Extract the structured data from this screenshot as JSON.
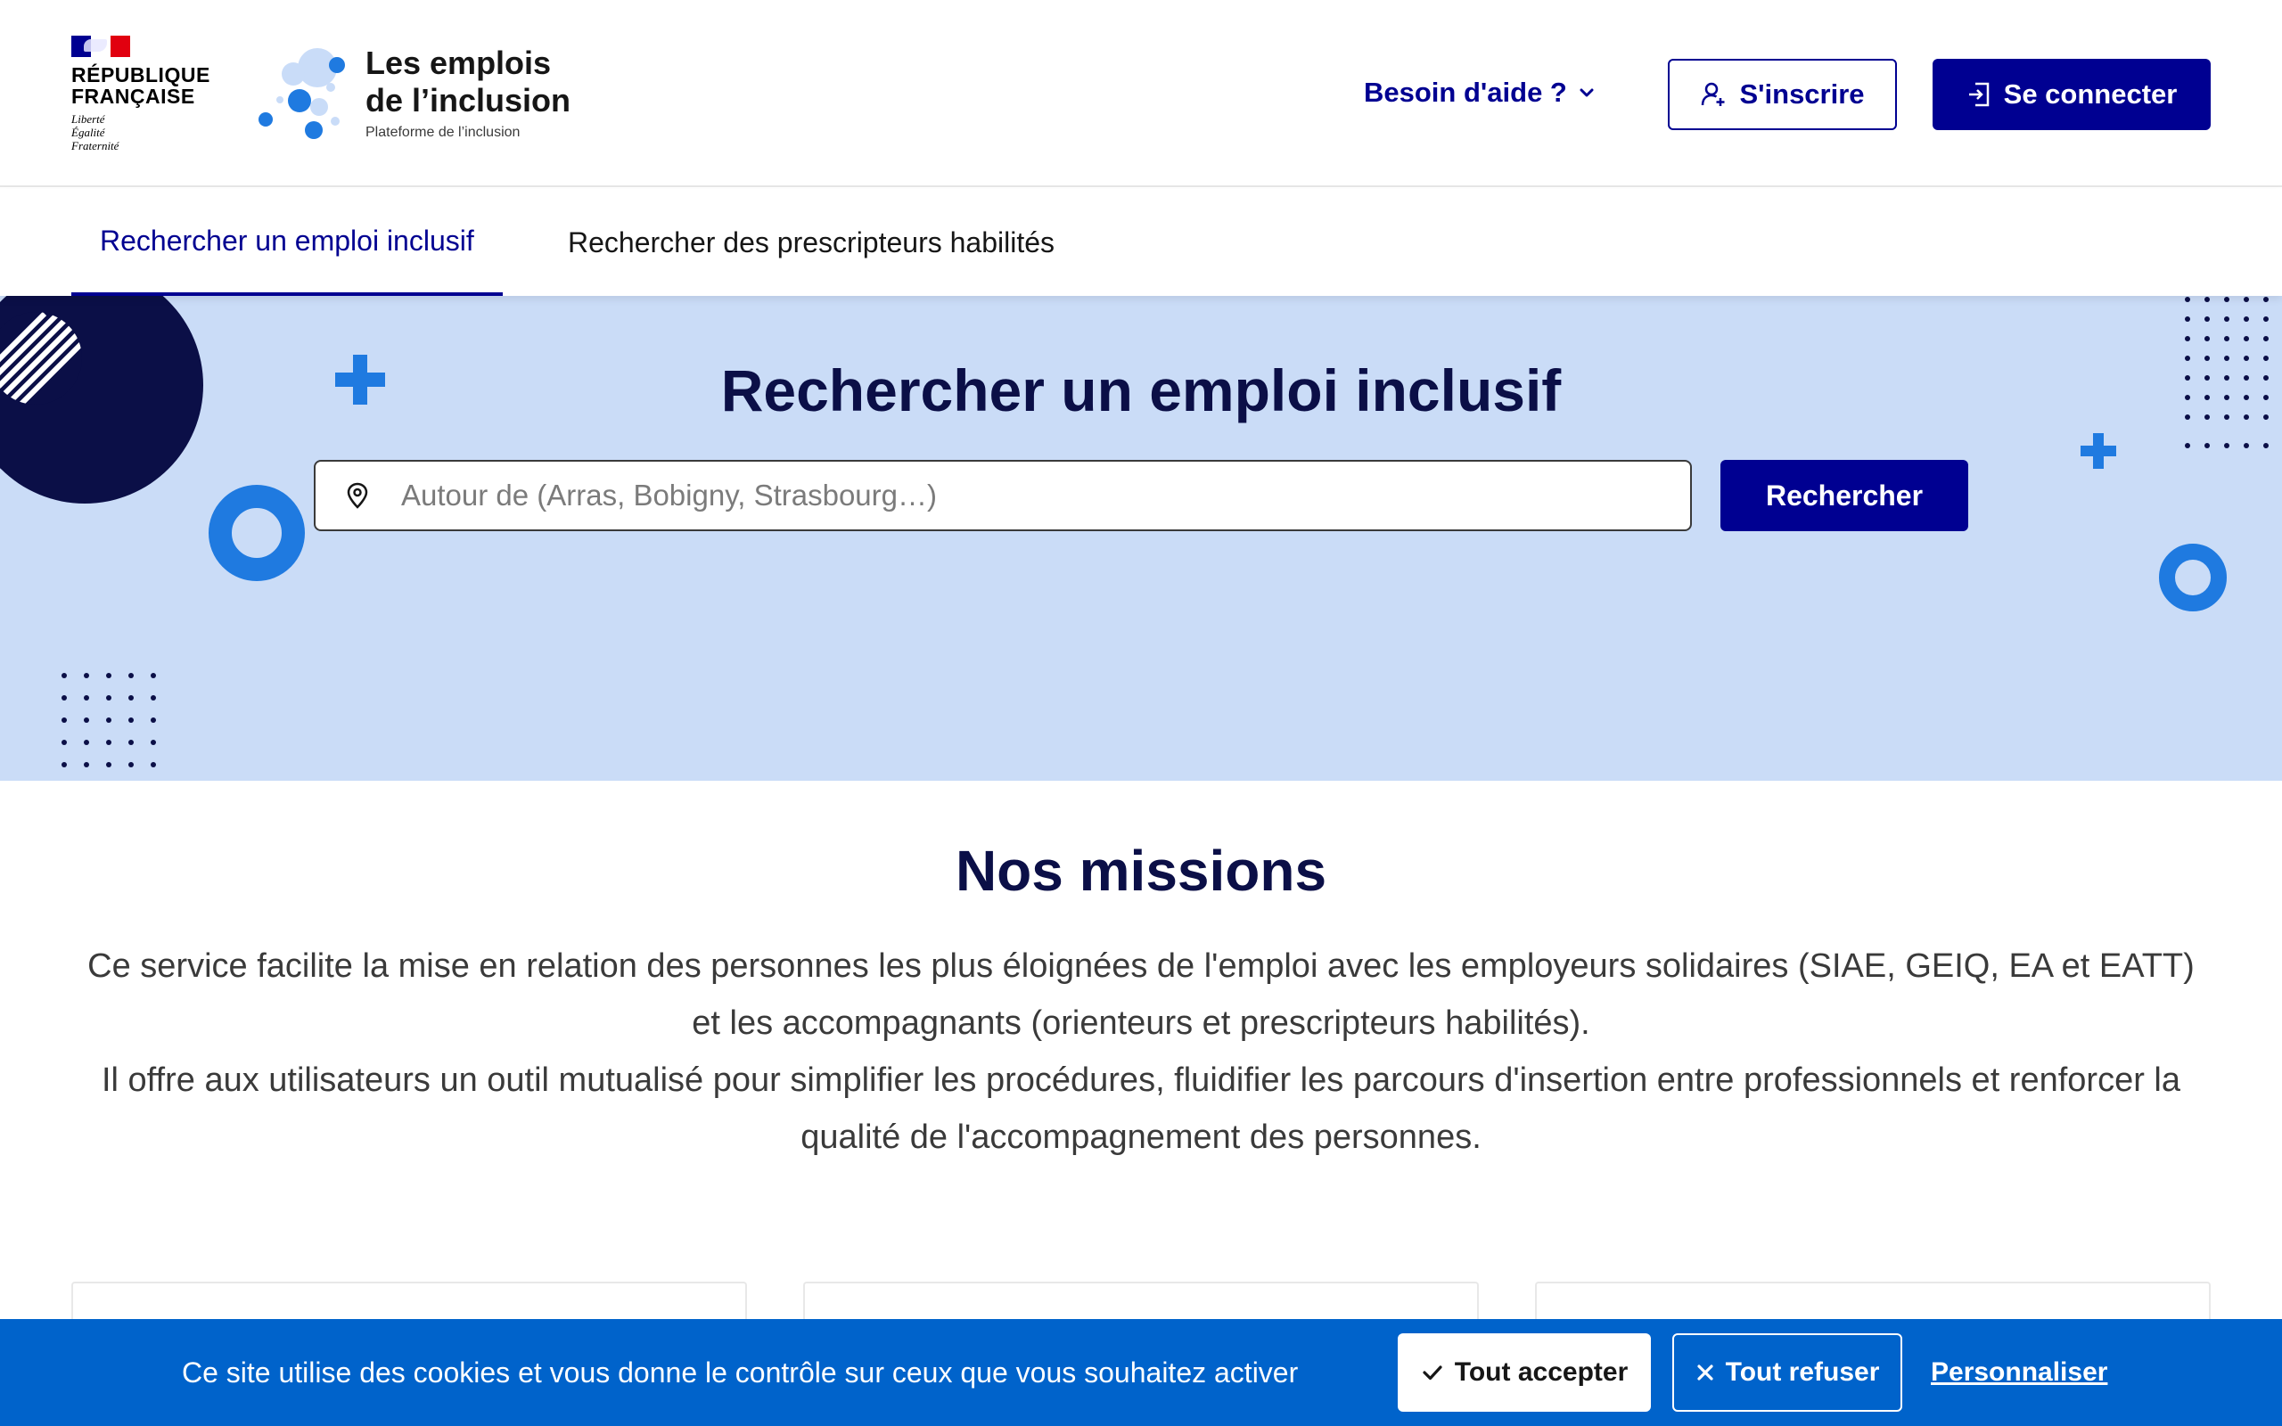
{
  "header": {
    "gov_name": [
      "RÉPUBLIQUE",
      "FRANÇAISE"
    ],
    "gov_motto": [
      "Liberté",
      "Égalité",
      "Fraternité"
    ],
    "service_title": [
      "Les emplois",
      "de l’inclusion"
    ],
    "service_tagline": "Plateforme de l’inclusion",
    "help_label": "Besoin d'aide ?",
    "register_label": "S'inscrire",
    "login_label": "Se connecter"
  },
  "nav": {
    "tabs": [
      {
        "label": "Rechercher un emploi inclusif",
        "active": true
      },
      {
        "label": "Rechercher des prescripteurs habilités",
        "active": false
      }
    ]
  },
  "hero": {
    "title": "Rechercher un emploi inclusif",
    "search_placeholder": "Autour de (Arras, Bobigny, Strasbourg…)",
    "search_value": "",
    "search_button": "Rechercher"
  },
  "missions": {
    "title": "Nos missions",
    "paragraphs": [
      "Ce service facilite la mise en relation des personnes les plus éloignées de l'emploi avec les employeurs solidaires (SIAE, GEIQ, EA et EATT) et les accompagnants (orienteurs et prescripteurs habilités).",
      "Il offre aux utilisateurs un outil mutualisé pour simplifier les procédures, fluidifier les parcours d'insertion entre professionnels et renforcer la qualité de l'accompagnement des personnes."
    ]
  },
  "cookie_banner": {
    "text": "Ce site utilise des cookies et vous donne le contrôle sur ceux que vous souhaitez activer",
    "accept_label": "Tout accepter",
    "refuse_label": "Tout refuser",
    "customize_label": "Personnaliser"
  },
  "icons": {
    "help_chevron": "chevron-down-icon",
    "register": "user-add-icon",
    "login": "login-icon",
    "search_location": "map-pin-icon",
    "accept": "check-icon",
    "refuse": "close-icon"
  },
  "colors": {
    "primary": "#000091",
    "hero_bg": "#cadcf7",
    "accent_blue": "#1f7ae0",
    "banner_blue": "#0063cb",
    "title_navy": "#0b0f47",
    "flag_blue": "#000091",
    "flag_red": "#e1000f"
  }
}
